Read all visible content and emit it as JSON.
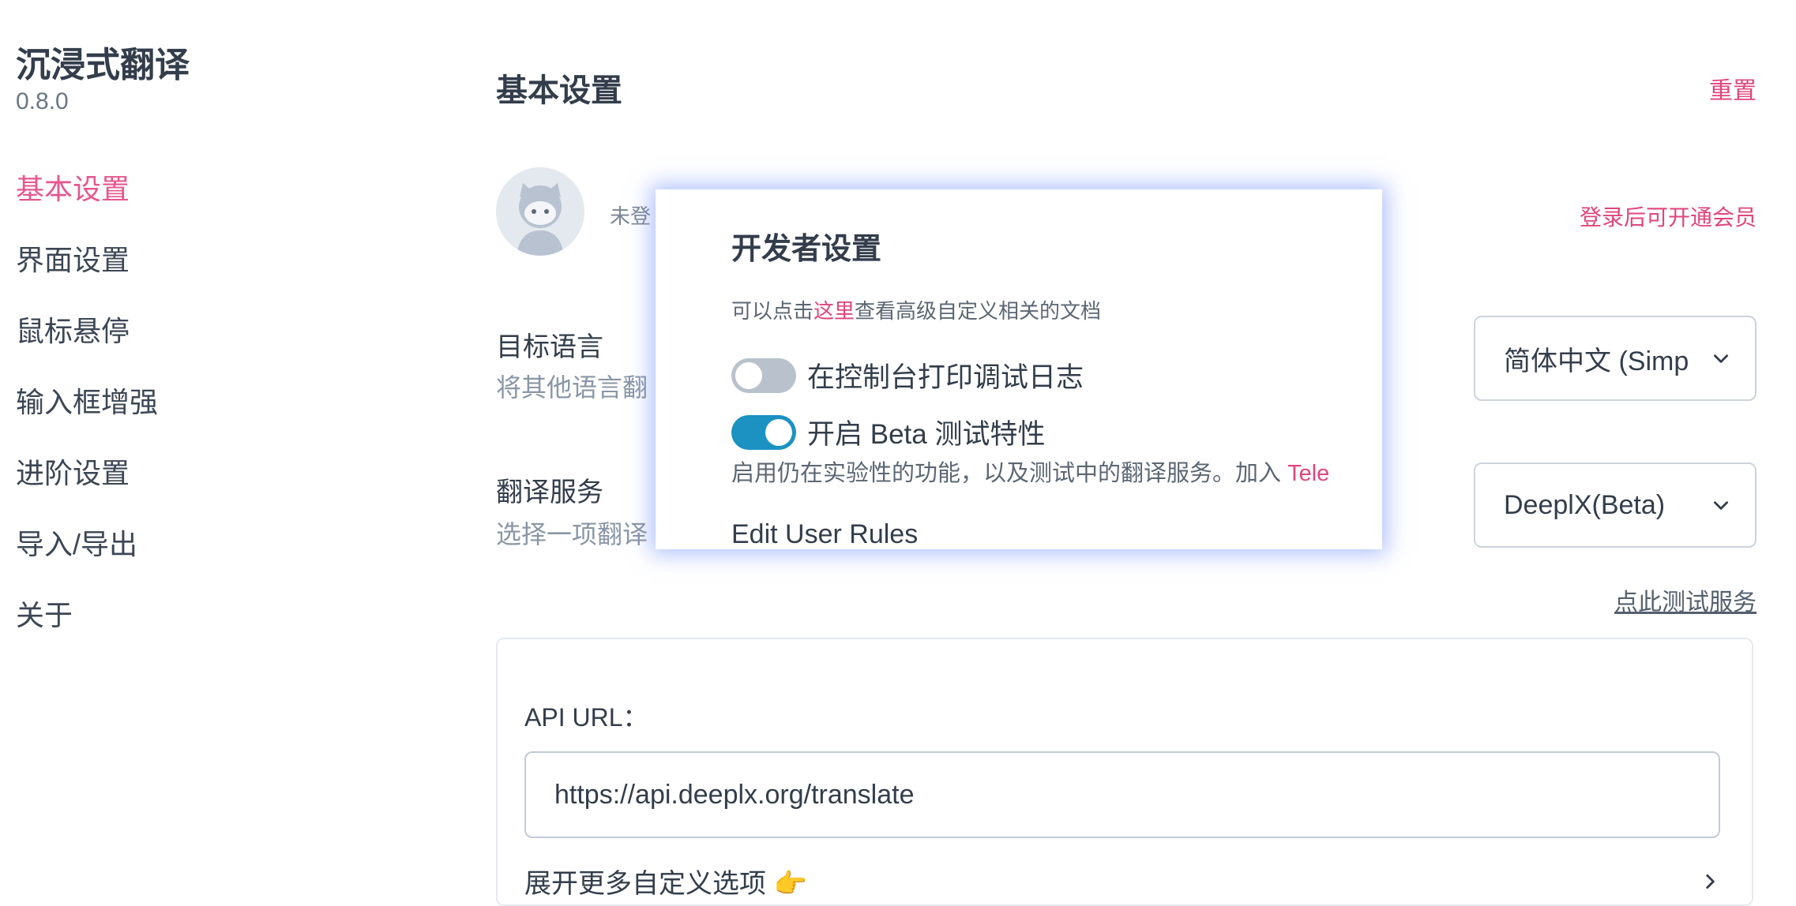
{
  "sidebar": {
    "app_title": "沉浸式翻译",
    "version": "0.8.0",
    "items": [
      {
        "label": "基本设置",
        "active": true
      },
      {
        "label": "界面设置"
      },
      {
        "label": "鼠标悬停"
      },
      {
        "label": "输入框增强"
      },
      {
        "label": "进阶设置"
      },
      {
        "label": "导入/导出"
      },
      {
        "label": "关于"
      }
    ]
  },
  "main": {
    "title": "基本设置",
    "reset_label": "重置",
    "account": {
      "status": "未登",
      "member_link": "登录后可开通会员"
    },
    "target_language": {
      "label": "目标语言",
      "description": "将其他语言翻",
      "value": "简体中文 (Simp"
    },
    "translation_service": {
      "label": "翻译服务",
      "description": "选择一项翻译",
      "value": "DeeplX(Beta)",
      "test_link": "点此测试服务"
    },
    "service_card": {
      "api_label": "API URL：",
      "api_value": "https://api.deeplx.org/translate",
      "expand_label": "展开更多自定义选项 👉"
    }
  },
  "modal": {
    "title": "开发者设置",
    "doc_prefix": "可以点击",
    "doc_link": "这里",
    "doc_suffix": "查看高级自定义相关的文档",
    "debug_log": {
      "label": "在控制台打印调试日志",
      "enabled": false
    },
    "beta": {
      "label": "开启 Beta 测试特性",
      "enabled": true
    },
    "beta_desc": "启用仍在实验性的功能，以及测试中的翻译服务。加入 ",
    "beta_desc_link": "Tele",
    "edit_rules": "Edit User Rules"
  },
  "colors": {
    "accent": "#e0457b",
    "toggle_on": "#1b92c2",
    "toggle_off": "#b9c2cc"
  }
}
